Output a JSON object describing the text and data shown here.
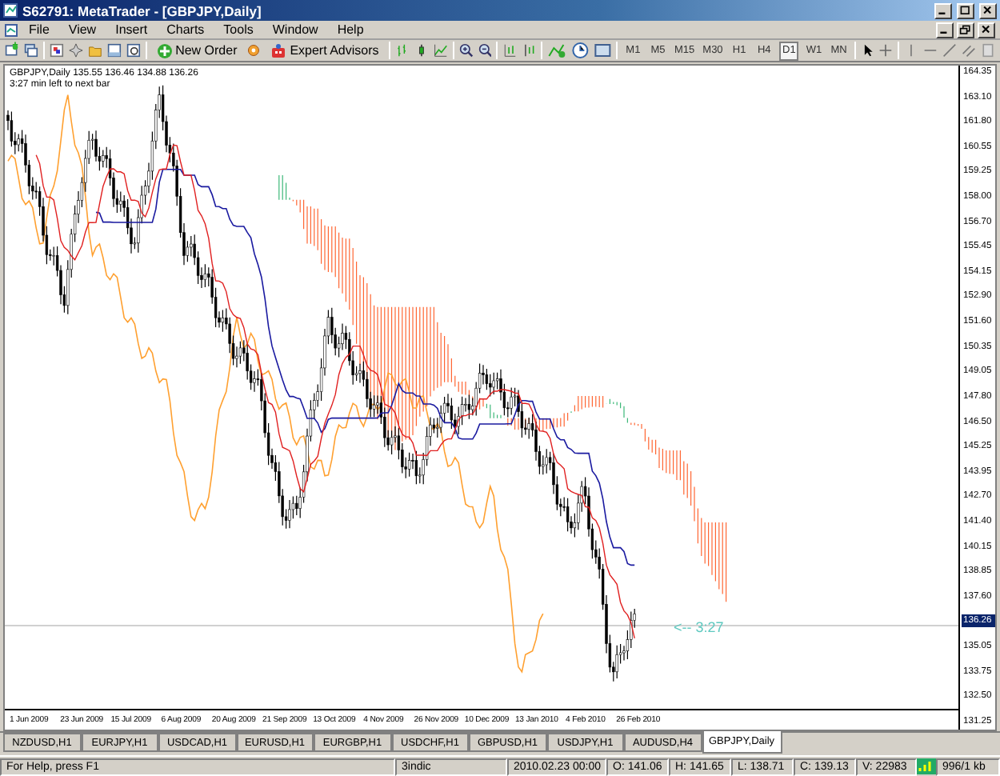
{
  "window": {
    "title": "S62791: MetaTrader - [GBPJPY,Daily]"
  },
  "menu": [
    "File",
    "View",
    "Insert",
    "Charts",
    "Tools",
    "Window",
    "Help"
  ],
  "toolbar": {
    "buttons": [
      "New Order",
      "Expert Advisors"
    ],
    "timeframes": [
      {
        "label": "M1",
        "selected": false
      },
      {
        "label": "M5",
        "selected": false
      },
      {
        "label": "M15",
        "selected": false
      },
      {
        "label": "M30",
        "selected": false
      },
      {
        "label": "H1",
        "selected": false
      },
      {
        "label": "H4",
        "selected": false
      },
      {
        "label": "D1",
        "selected": true
      },
      {
        "label": "W1",
        "selected": false
      },
      {
        "label": "MN",
        "selected": false
      }
    ]
  },
  "chart": {
    "info": "GBPJPY,Daily  135.55 136.46 134.88 136.26",
    "timer": "3:27 min left to next bar",
    "countdown": "<-- 3:27",
    "price_axis": [
      {
        "label": "164.35",
        "kind": "tick"
      },
      {
        "label": "163.10",
        "kind": "tick"
      },
      {
        "label": "161.80",
        "kind": "tick"
      },
      {
        "label": "160.55",
        "kind": "tick"
      },
      {
        "label": "159.25",
        "kind": "tick"
      },
      {
        "label": "158.00",
        "kind": "tick"
      },
      {
        "label": "156.70",
        "kind": "tick"
      },
      {
        "label": "155.45",
        "kind": "tick"
      },
      {
        "label": "154.15",
        "kind": "tick"
      },
      {
        "label": "152.90",
        "kind": "tick"
      },
      {
        "label": "151.60",
        "kind": "tick"
      },
      {
        "label": "150.35",
        "kind": "tick"
      },
      {
        "label": "149.05",
        "kind": "tick"
      },
      {
        "label": "147.80",
        "kind": "tick"
      },
      {
        "label": "146.50",
        "kind": "tick"
      },
      {
        "label": "145.25",
        "kind": "tick"
      },
      {
        "label": "143.95",
        "kind": "tick"
      },
      {
        "label": "142.70",
        "kind": "tick"
      },
      {
        "label": "141.40",
        "kind": "tick"
      },
      {
        "label": "140.15",
        "kind": "tick"
      },
      {
        "label": "138.85",
        "kind": "tick"
      },
      {
        "label": "137.60",
        "kind": "tick"
      },
      {
        "label": "136.26",
        "kind": "current"
      },
      {
        "label": "135.05",
        "kind": "tick"
      },
      {
        "label": "133.75",
        "kind": "tick"
      },
      {
        "label": "132.50",
        "kind": "tick"
      },
      {
        "label": "131.25",
        "kind": "tick"
      }
    ],
    "time_axis": [
      "1 Jun 2009",
      "23 Jun 2009",
      "15 Jul 2009",
      "6 Aug 2009",
      "20 Aug 2009",
      "21 Sep 2009",
      "13 Oct 2009",
      "4 Nov 2009",
      "26 Nov 2009",
      "10 Dec 2009",
      "13 Jan 2010",
      "4 Feb 2010",
      "26 Feb 2010"
    ]
  },
  "tabs": [
    {
      "label": "NZDUSD,H1",
      "selected": false
    },
    {
      "label": "EURJPY,H1",
      "selected": false
    },
    {
      "label": "USDCAD,H1",
      "selected": false
    },
    {
      "label": "EURUSD,H1",
      "selected": false
    },
    {
      "label": "EURGBP,H1",
      "selected": false
    },
    {
      "label": "USDCHF,H1",
      "selected": false
    },
    {
      "label": "GBPUSD,H1",
      "selected": false
    },
    {
      "label": "USDJPY,H1",
      "selected": false
    },
    {
      "label": "AUDUSD,H4",
      "selected": false
    },
    {
      "label": "GBPJPY,Daily",
      "selected": true
    }
  ],
  "status_bar": {
    "help": "For Help, press F1",
    "profile": "3indic",
    "time": "2010.02.23 00:00",
    "open": "O: 141.06",
    "high": "H: 141.65",
    "low": "L: 138.71",
    "close": "C: 139.13",
    "volume": "V: 22983",
    "traffic": "996/1 kb"
  }
}
